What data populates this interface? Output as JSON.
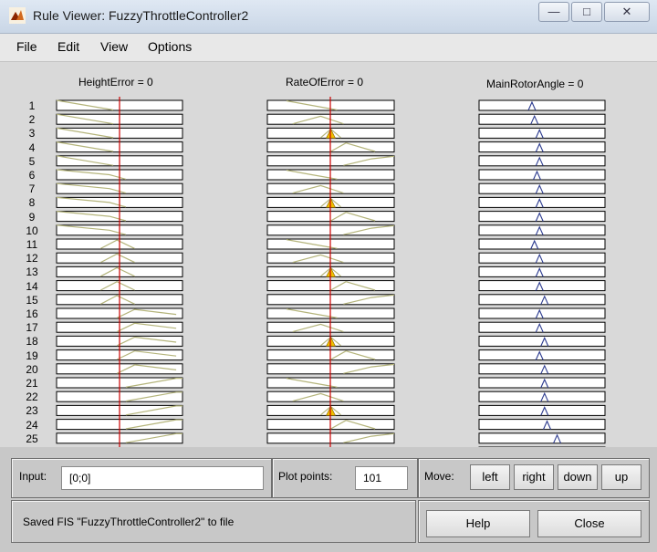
{
  "window": {
    "title": "Rule Viewer: FuzzyThrottleController2"
  },
  "titlebar_buttons": [
    "minimize",
    "maximize",
    "close"
  ],
  "menu": [
    "File",
    "Edit",
    "View",
    "Options"
  ],
  "variables": [
    {
      "label": "HeightError = 0"
    },
    {
      "label": "RateOfError = 0"
    },
    {
      "label": "MainRotorAngle = 0"
    }
  ],
  "rules": [
    "1",
    "2",
    "3",
    "4",
    "5",
    "6",
    "7",
    "8",
    "9",
    "10",
    "11",
    "12",
    "13",
    "14",
    "15",
    "16",
    "17",
    "18",
    "19",
    "20",
    "21",
    "22",
    "23",
    "24",
    "25"
  ],
  "input": {
    "label": "Input:",
    "value": "[0;0]"
  },
  "plot_points": {
    "label": "Plot points:",
    "value": "101"
  },
  "move": {
    "label": "Move:",
    "buttons": [
      "left",
      "right",
      "down",
      "up"
    ]
  },
  "status": "Saved FIS \"FuzzyThrottleController2\" to file",
  "actions": {
    "help": "Help",
    "close": "Close"
  },
  "colors": {
    "input_mf": "#b5b57c",
    "output_mf": "#2b3a8f",
    "fire": "#f0c000",
    "indicator": "#cc0000"
  }
}
